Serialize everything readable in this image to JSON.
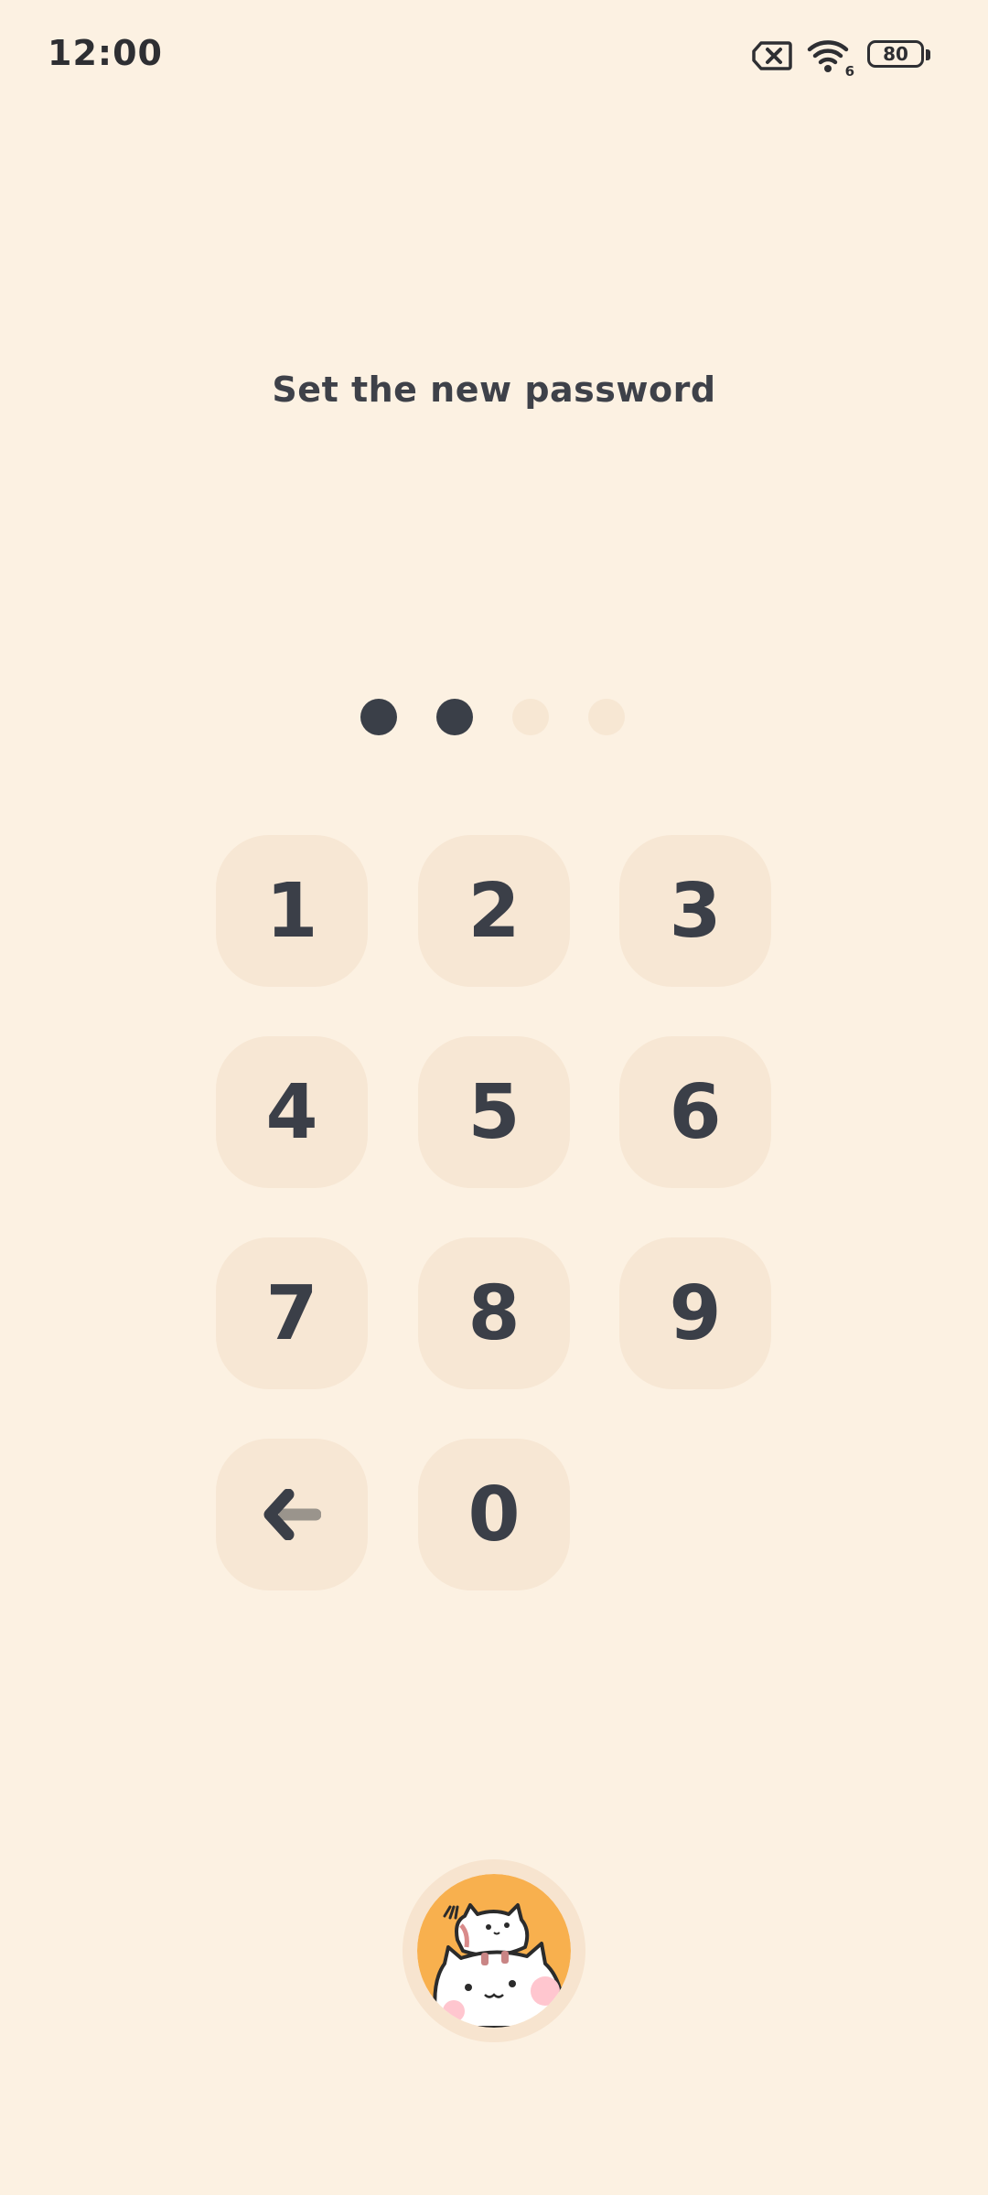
{
  "status_bar": {
    "time": "12:00",
    "wifi_label": "6",
    "battery_level": "80",
    "icons": [
      "no-sim-icon",
      "wifi-icon",
      "battery-icon"
    ]
  },
  "title": "Set the new password",
  "pin": {
    "length": 4,
    "entered": 2
  },
  "keypad": {
    "key_1": "1",
    "key_2": "2",
    "key_3": "3",
    "key_4": "4",
    "key_5": "5",
    "key_6": "6",
    "key_7": "7",
    "key_8": "8",
    "key_9": "9",
    "key_0": "0",
    "backspace_icon": "backspace-arrow-icon"
  },
  "avatar": {
    "icon": "cats-avatar-icon"
  },
  "colors": {
    "background": "#fcf1e2",
    "key_background": "#f7e7d4",
    "text": "#3b3f48",
    "avatar_accent": "#f8b04e"
  }
}
